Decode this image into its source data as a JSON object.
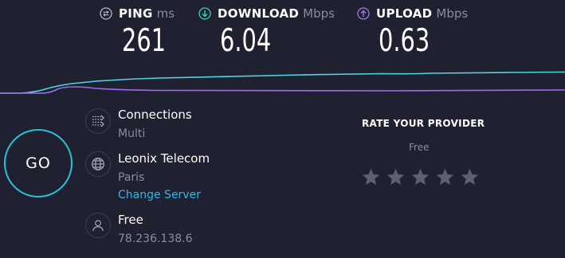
{
  "metrics": {
    "ping": {
      "label": "PING",
      "unit": "ms",
      "value": "261",
      "icon": "ping-icon",
      "color": "#b5b7c4"
    },
    "download": {
      "label": "DOWNLOAD",
      "unit": "Mbps",
      "value": "6.04",
      "icon": "download-arrow-icon",
      "color": "#2ed3c7"
    },
    "upload": {
      "label": "UPLOAD",
      "unit": "Mbps",
      "value": "0.63",
      "icon": "upload-arrow-icon",
      "color": "#a77be0"
    }
  },
  "graph": {
    "download_color": "#4ed6e4",
    "upload_color": "#9b6cf0"
  },
  "go_button": {
    "label": "GO",
    "ring_color": "#28c3d6"
  },
  "connections": {
    "title": "Connections",
    "value": "Multi",
    "icon": "connections-icon"
  },
  "server": {
    "name": "Leonix Telecom",
    "location": "Paris",
    "change_link": "Change Server",
    "icon": "globe-icon",
    "link_color": "#34b5e5"
  },
  "user": {
    "provider": "Free",
    "ip": "78.236.138.6",
    "icon": "user-icon"
  },
  "rating": {
    "heading": "RATE YOUR PROVIDER",
    "provider": "Free",
    "stars_total": 5,
    "stars_filled": 0,
    "star_color": "#5e6070"
  },
  "theme": {
    "background": "#1f2030",
    "muted_text": "#8b8d9c"
  }
}
